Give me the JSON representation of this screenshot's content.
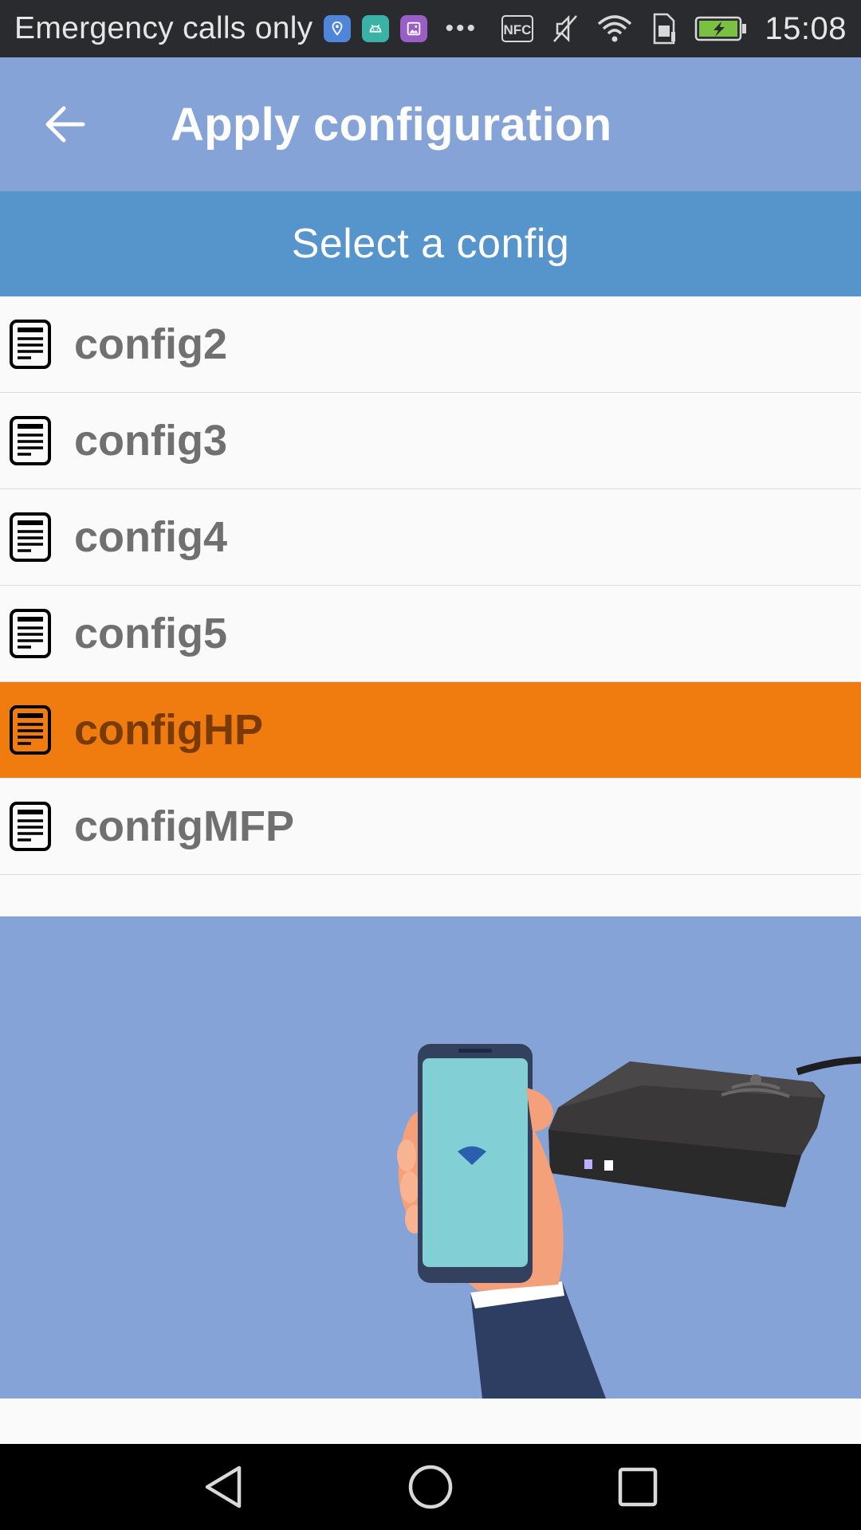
{
  "status_bar": {
    "carrier_text": "Emergency calls only",
    "nfc_label": "NFC",
    "time": "15:08",
    "notification_icons": [
      "location-icon",
      "android-icon",
      "gallery-icon"
    ]
  },
  "app_bar": {
    "title": "Apply configuration",
    "back_icon": "arrow-left-icon"
  },
  "section_header": {
    "title": "Select a config"
  },
  "configs": [
    {
      "label": "config2",
      "selected": false
    },
    {
      "label": "config3",
      "selected": false
    },
    {
      "label": "config4",
      "selected": false
    },
    {
      "label": "config5",
      "selected": false
    },
    {
      "label": "configHP",
      "selected": true
    },
    {
      "label": "configMFP",
      "selected": false
    }
  ],
  "colors": {
    "app_bar": "#85a3d6",
    "section_header": "#5694cc",
    "selected_item": "#f07b0e",
    "illustration_bg": "#85a3d6"
  },
  "navigation": {
    "buttons": [
      "back-triangle-icon",
      "home-circle-icon",
      "recents-square-icon"
    ]
  }
}
